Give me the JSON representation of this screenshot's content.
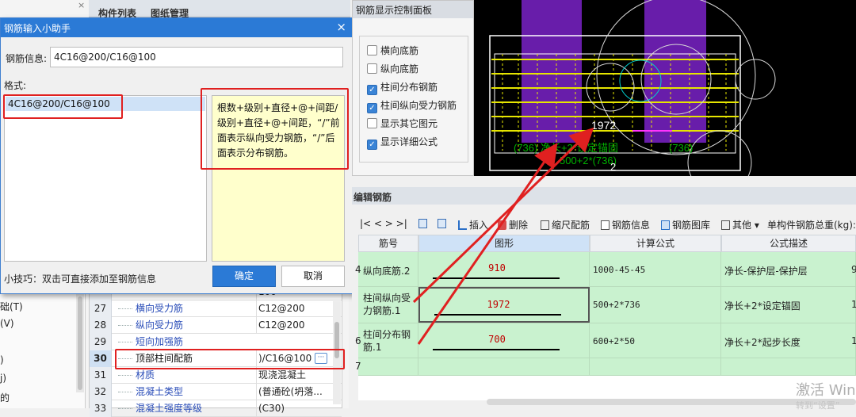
{
  "left_panel": {
    "tabs": [
      "构件列表",
      "图纸管理"
    ],
    "side_items": [
      "础(T)",
      "(V)",
      "",
      ")",
      "j)",
      "的"
    ]
  },
  "dialog": {
    "title": "钢筋输入小助手",
    "info_label": "钢筋信息:",
    "info_value": "4C16@200/C16@100",
    "format_label": "格式:",
    "format_item": "4C16@200/C16@100",
    "format_desc": "根数+级别+直径+@+间距/级别+直径+@+间距，“/”前面表示纵向受力钢筋，“/”后面表示分布钢筋。",
    "tip": "小技巧：双击可直接添加至钢筋信息",
    "ok": "确定",
    "cancel": "取消",
    "close": "×"
  },
  "property_grid": {
    "rows": [
      {
        "num": "",
        "name": "",
        "value": "100"
      },
      {
        "num": "27",
        "name": "横向受力筋",
        "value": "C12@200"
      },
      {
        "num": "28",
        "name": "纵向受力筋",
        "value": "C12@200"
      },
      {
        "num": "29",
        "name": "短向加强筋",
        "value": ""
      },
      {
        "num": "30",
        "name": "顶部柱间配筋",
        "value": ")/C16@100"
      },
      {
        "num": "31",
        "name": "材质",
        "value": "现浇混凝土"
      },
      {
        "num": "32",
        "name": "混凝土类型",
        "value": "(普通砼(坍落..."
      },
      {
        "num": "33",
        "name": "混凝土强度等级",
        "value": "(C30)"
      }
    ],
    "ellipsis": "···"
  },
  "control_panel": {
    "title": "钢筋显示控制面板",
    "options": [
      {
        "label": "横向底筋",
        "checked": false
      },
      {
        "label": "纵向底筋",
        "checked": false
      },
      {
        "label": "柱间分布钢筋",
        "checked": true
      },
      {
        "label": "柱间纵向受力钢筋",
        "checked": true
      },
      {
        "label": "显示其它图元",
        "checked": false
      },
      {
        "label": "显示详细公式",
        "checked": true
      }
    ],
    "check_glyph": "✓"
  },
  "cad": {
    "value_label": "1972",
    "green_text_1": "(736) 净长+2*设定锚固",
    "green_text_2": "(736)",
    "green_text_3": "500+2*(736)",
    "marker": "2",
    "accent_purple": "#7a22c8",
    "accent_yellow": "#e6e600"
  },
  "edit": {
    "title": "编辑钢筋",
    "toolbar": {
      "nav": "|<  <  >  >|",
      "insert": "插入",
      "delete": "删除",
      "scale": "缩尺配筋",
      "info": "钢筋信息",
      "library": "钢筋图库",
      "other": "其他",
      "total": "单构件钢筋总重(kg):"
    },
    "headers": [
      "筋号",
      "图形",
      "计算公式",
      "公式描述"
    ],
    "rows": [
      {
        "idx": "4",
        "name": "纵向底筋.2",
        "fig": "910",
        "calc": "1000-45-45",
        "desc": "净长-保护层-保护层",
        "extra": "9"
      },
      {
        "idx": "",
        "name": "柱间纵向受力钢筋.1",
        "fig": "1972",
        "calc": "500+2*736",
        "desc": "净长+2*设定锚固",
        "extra": "1"
      },
      {
        "idx": "6",
        "name": "柱间分布钢筋.1",
        "fig": "700",
        "calc": "600+2*50",
        "desc": "净长+2*起步长度",
        "extra": "1"
      },
      {
        "idx": "7",
        "name": "",
        "fig": "",
        "calc": "",
        "desc": "",
        "extra": ""
      }
    ]
  },
  "watermark": {
    "line1": "激活 Win",
    "line2": "转到“设置”"
  }
}
